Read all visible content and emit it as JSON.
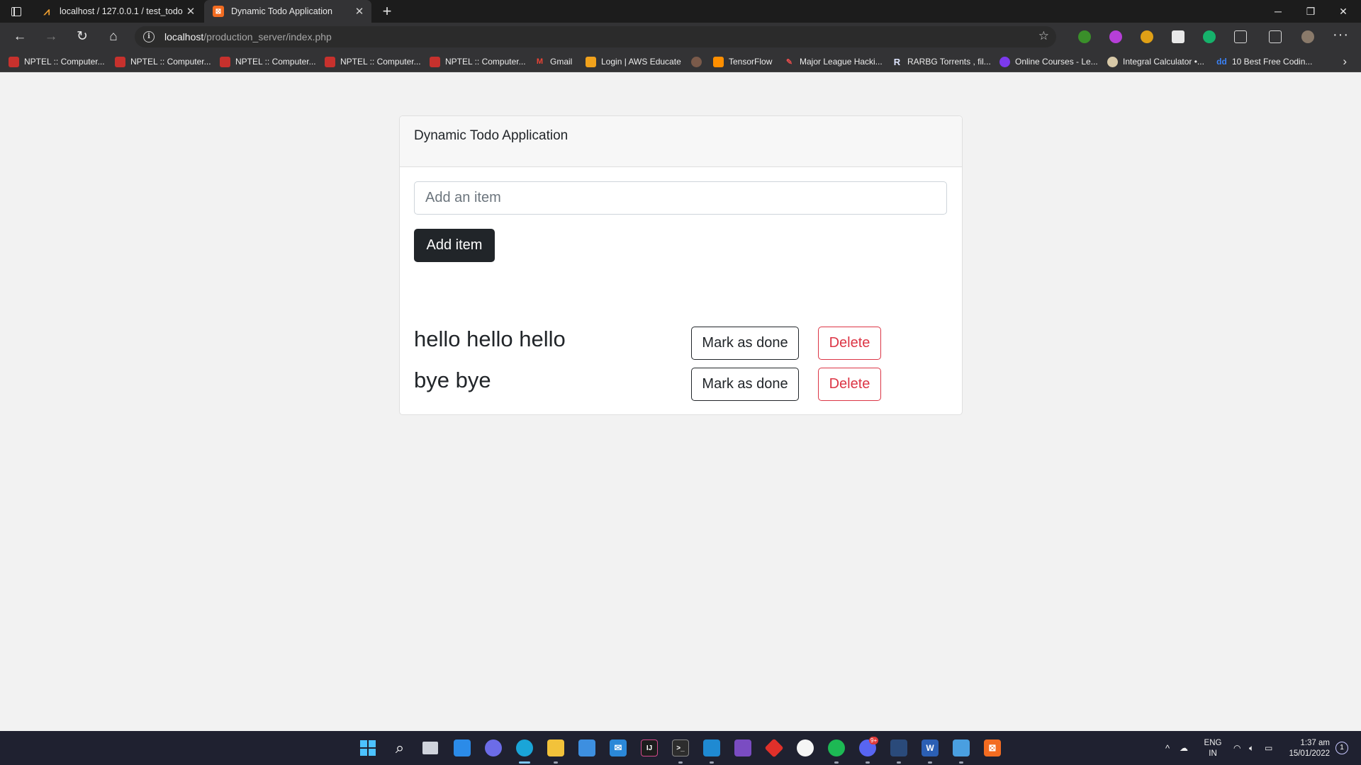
{
  "browser": {
    "tabs": [
      {
        "title": "localhost / 127.0.0.1 / test_todo",
        "active": false
      },
      {
        "title": "Dynamic Todo Application",
        "active": true
      }
    ],
    "new_tab_symbol": "+",
    "url_host": "localhost",
    "url_path": "/production_server/index.php",
    "bookmarks": [
      {
        "label": "NPTEL :: Computer...",
        "icon": "nptel-icon"
      },
      {
        "label": "NPTEL :: Computer...",
        "icon": "nptel-icon"
      },
      {
        "label": "NPTEL :: Computer...",
        "icon": "nptel-icon"
      },
      {
        "label": "NPTEL :: Computer...",
        "icon": "nptel-icon"
      },
      {
        "label": "NPTEL :: Computer...",
        "icon": "nptel-icon"
      },
      {
        "label": "Gmail",
        "icon": "gmail-icon"
      },
      {
        "label": "Login | AWS Educate",
        "icon": "aws-icon"
      },
      {
        "label": "",
        "icon": "person-icon"
      },
      {
        "label": "TensorFlow",
        "icon": "tensorflow-icon"
      },
      {
        "label": "Major League Hacki...",
        "icon": "mlh-icon"
      },
      {
        "label": "RARBG Torrents , fil...",
        "icon": "rarbg-icon"
      },
      {
        "label": "Online Courses - Le...",
        "icon": "udemy-icon"
      },
      {
        "label": "Integral Calculator •...",
        "icon": "calculator-icon"
      },
      {
        "label": "10 Best Free Codin...",
        "icon": "dd-icon"
      }
    ]
  },
  "app": {
    "header": "Dynamic Todo Application",
    "input_placeholder": "Add an item",
    "add_button": "Add item",
    "items": [
      {
        "text": "hello hello hello",
        "done_label": "Mark as done",
        "delete_label": "Delete"
      },
      {
        "text": "bye bye",
        "done_label": "Mark as done",
        "delete_label": "Delete"
      }
    ]
  },
  "taskbar": {
    "language": "ENG",
    "region": "IN",
    "time": "1:37 am",
    "date": "15/01/2022",
    "notification_count": "1",
    "discord_badge": "9+"
  },
  "colors": {
    "danger": "#dc3545",
    "dark": "#212529",
    "page_bg": "#f2f2f2"
  }
}
